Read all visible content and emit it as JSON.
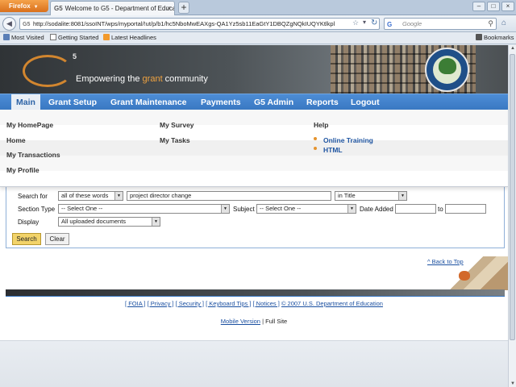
{
  "browser": {
    "app_button": "Firefox",
    "tab_favicon": "G5",
    "tab_title": "Welcome to G5 - Department of Educati...",
    "url_favicon": "G5",
    "url": "http://sodalite:8081/ssoINT/wps/myportal/!ut/p/b1/hc5NboMwEAXgs-QA1Yz5sb11EaGtY1DBQZgNQkIUQYKtlkpl",
    "search_engine_icon": "G",
    "search_placeholder": "Google",
    "bookmarks": [
      {
        "label": "Most Visited",
        "icon": "most-visited-icon"
      },
      {
        "label": "Getting Started",
        "icon": "page-icon"
      },
      {
        "label": "Latest Headlines",
        "icon": "rss-icon"
      }
    ],
    "bookmarks_menu": "Bookmarks"
  },
  "banner": {
    "logo_sup": "5",
    "tagline_before": "Empowering the ",
    "tagline_highlight": "grant",
    "tagline_after": " community"
  },
  "menu": [
    {
      "label": "Main",
      "active": true
    },
    {
      "label": "Grant Setup",
      "active": false
    },
    {
      "label": "Grant Maintenance",
      "active": false
    },
    {
      "label": "Payments",
      "active": false
    },
    {
      "label": "G5 Admin",
      "active": false
    },
    {
      "label": "Reports",
      "active": false
    },
    {
      "label": "Logout",
      "active": false
    }
  ],
  "dropdown": {
    "col1": [
      "My HomePage",
      "Home",
      "My Transactions",
      "My Profile"
    ],
    "col2": [
      "My Survey",
      "My Tasks"
    ],
    "col3_heading": "Help",
    "col3_links": [
      "Online Training",
      "HTML"
    ]
  },
  "search": {
    "search_for_label": "Search for",
    "match_mode": "all of these words",
    "query": "project director change",
    "scope": "in Title",
    "section_type_label": "Section Type",
    "section_type_value": "-- Select One --",
    "subject_label": "Subject",
    "subject_value": "-- Select One --",
    "date_added_label": "Date Added",
    "date_to_label": "to",
    "date_from_value": "",
    "date_to_value": "",
    "display_label": "Display",
    "display_value": "All uploaded documents",
    "search_button": "Search",
    "clear_button": "Clear"
  },
  "footer": {
    "back_to_top": "^ Back to Top",
    "links": [
      "[ FOIA ]",
      "[ Privacy ]",
      "[ Security ]",
      "[ Keyboard Tips ]",
      "[ Notices ]",
      "© 2007 U.S. Department of Education"
    ],
    "mobile_version": "Mobile Version",
    "separator": "|",
    "full_site": "Full Site"
  }
}
